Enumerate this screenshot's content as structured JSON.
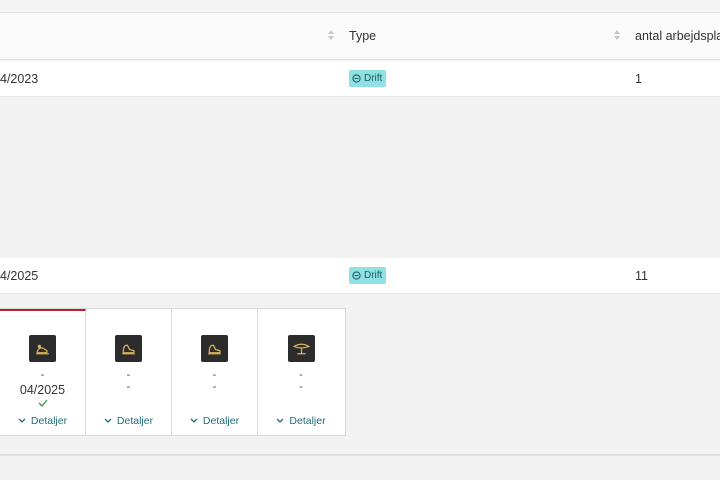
{
  "columns": [
    {
      "label": ""
    },
    {
      "label": "Type"
    },
    {
      "label": "antal arbejdspla"
    }
  ],
  "rows": [
    {
      "date": "4/2023",
      "type": "Drift",
      "count": "1"
    },
    {
      "date": "4/2025",
      "type": "Drift",
      "count": "11"
    }
  ],
  "cards": [
    {
      "icon": "sensor-icon",
      "line1": "-",
      "date": "04/2025",
      "checked": true,
      "details": "Detaljer"
    },
    {
      "icon": "sensor-icon",
      "line1": "-",
      "line2": "-",
      "details": "Detaljer"
    },
    {
      "icon": "sensor-icon",
      "line1": "-",
      "line2": "-",
      "details": "Detaljer"
    },
    {
      "icon": "lamp-icon",
      "line1": "-",
      "line2": "-",
      "details": "Detaljer"
    }
  ],
  "colors": {
    "tag_bg": "#8fe1e3",
    "active_card_border": "#b3232a",
    "link": "#1f6e78"
  }
}
